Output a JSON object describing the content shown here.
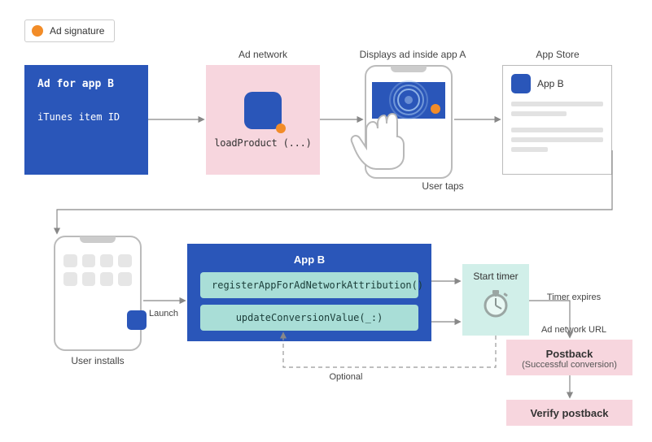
{
  "legend": {
    "label": "Ad signature"
  },
  "row1": {
    "ad_block": {
      "title": "Ad for app B",
      "subtitle": "iTunes item ID"
    },
    "ad_network": {
      "heading": "Ad network",
      "code": "loadProduct (...)"
    },
    "display_ad": {
      "heading": "Displays ad inside app A",
      "sub": "User taps"
    },
    "app_store": {
      "heading": "App Store",
      "app_label": "App B"
    }
  },
  "row2": {
    "install_phone": {
      "caption": "User installs",
      "launch_label": "Launch"
    },
    "app_b_box": {
      "title": "App B",
      "fn_register": "registerAppForAdNetworkAttribution()",
      "fn_update": "updateConversionValue(_:)",
      "optional_label": "Optional"
    },
    "timer": {
      "label": "Start timer",
      "expires_label": "Timer expires"
    },
    "postback": {
      "heading": "Ad network URL",
      "title": "Postback",
      "subtitle": "(Successful conversion)"
    },
    "verify": {
      "title": "Verify postback"
    }
  }
}
